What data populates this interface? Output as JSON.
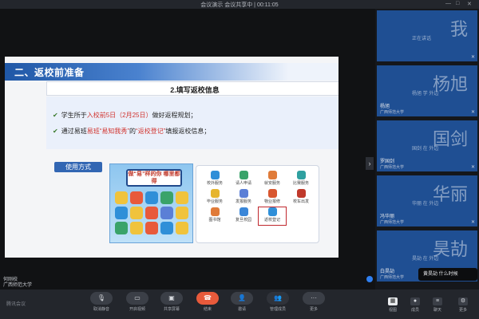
{
  "window": {
    "title": "会议演示 会议共享中 | 00:11:05",
    "controls": [
      "—",
      "□",
      "✕"
    ]
  },
  "slide": {
    "section_title": "二、返校前准备",
    "subtitle": "2.填写返校信息",
    "bullet1": {
      "pre": "学生所于",
      "highlight": "入校前5日（2月25日）",
      "post": "做好返程规划；"
    },
    "bullet2": {
      "pre": "通过易班",
      "highlight1": "易班“易知我秀”",
      "mid": "的",
      "highlight2": "“返校登记”",
      "post": "填报返校信息；"
    },
    "usage_label": "使用方式",
    "poster_text": "做“易”样的你 哪里都得"
  },
  "apps": [
    {
      "label": "校外服务",
      "color": "#2f8fd8"
    },
    {
      "label": "请人申请",
      "color": "#3aa36a"
    },
    {
      "label": "就安服务",
      "color": "#e07b39"
    },
    {
      "label": "比赛服务",
      "color": "#2fa0a0"
    },
    {
      "label": "毕业服务",
      "color": "#e6b52f"
    },
    {
      "label": "发报服务",
      "color": "#5b7fd6"
    },
    {
      "label": "物业报修",
      "color": "#d8562f"
    },
    {
      "label": "校车出发",
      "color": "#c0392b"
    },
    {
      "label": "图书馆",
      "color": "#e07b39"
    },
    {
      "label": "复旦校园",
      "color": "#3a86d8"
    },
    {
      "label": "返校登记",
      "color": "#2f8fd8",
      "selected": true
    }
  ],
  "presenter": {
    "name": "何刚校",
    "org": "广西师范大学"
  },
  "participants": [
    {
      "big": "我",
      "caption": "正在讲话",
      "name": "",
      "org": ""
    },
    {
      "big": "杨旭",
      "caption": "杨旭 学 外边",
      "name": "杨旭",
      "org": "广西师范大学"
    },
    {
      "big": "国剑",
      "caption": "国剑 在 外边",
      "name": "罗国剑",
      "org": "广西师范大学"
    },
    {
      "big": "华丽",
      "caption": "华丽 在 外边",
      "name": "冯华丽",
      "org": "广西师范大学"
    },
    {
      "big": "昊劼",
      "caption": "昊劼 在 外边",
      "name": "白昊劼",
      "org": "广西师范大学"
    }
  ],
  "toast": "黄昊劼 什么时候",
  "toolbar": {
    "items": [
      "取消静音",
      "开启视频",
      "共享屏幕",
      "结束",
      "邀请",
      "管理成员",
      "更多"
    ],
    "logo": "腾讯会议"
  },
  "right_toolbar": [
    "视图",
    "成员",
    "聊天",
    "更多"
  ],
  "colors": {
    "accent": "#1f57a6",
    "tile": "#1f4f93",
    "end_button": "#e85a3b",
    "highlight": "#d1332e"
  }
}
